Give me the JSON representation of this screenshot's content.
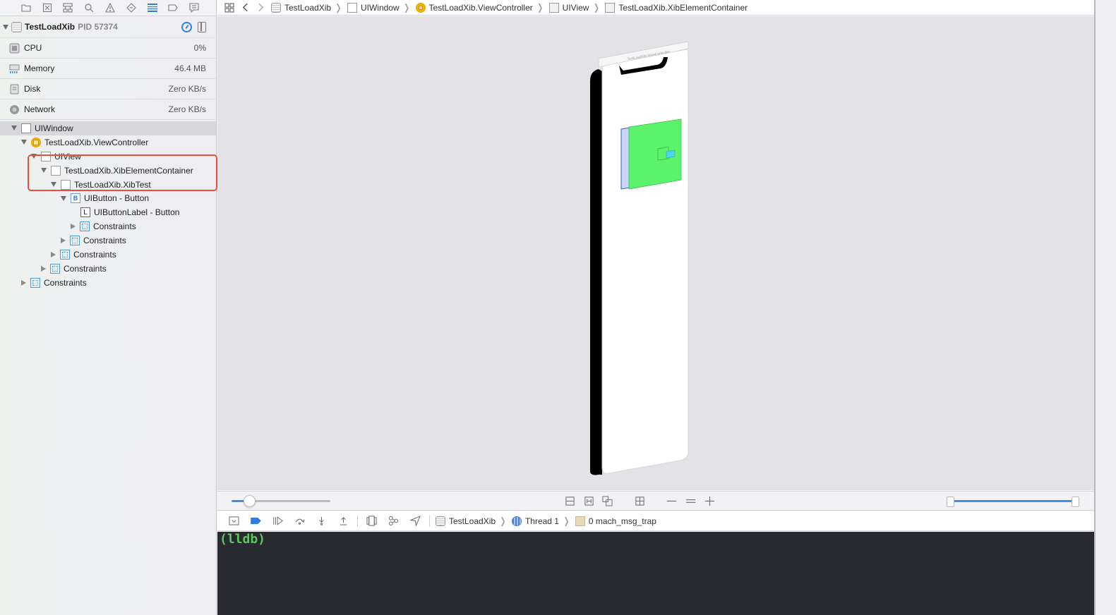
{
  "navigator": {
    "tabs": [
      {
        "icon": "folder-icon",
        "active": false
      },
      {
        "icon": "source-control-icon",
        "active": false
      },
      {
        "icon": "symbol-icon",
        "active": false
      },
      {
        "icon": "search-icon",
        "active": false
      },
      {
        "icon": "warning-icon",
        "active": false
      },
      {
        "icon": "test-icon",
        "active": false
      },
      {
        "icon": "debug-navigator-icon",
        "active": true
      },
      {
        "icon": "breakpoint-icon",
        "active": false
      },
      {
        "icon": "report-icon",
        "active": false
      }
    ],
    "process": {
      "name": "TestLoadXib",
      "pid_label": "PID 57374"
    },
    "gauges": [
      {
        "label": "CPU",
        "value": "0%",
        "icon": "cpu-icon"
      },
      {
        "label": "Memory",
        "value": "46.4 MB",
        "icon": "memory-icon"
      },
      {
        "label": "Disk",
        "value": "Zero KB/s",
        "icon": "disk-icon"
      },
      {
        "label": "Network",
        "value": "Zero KB/s",
        "icon": "network-icon"
      }
    ],
    "tree": [
      {
        "label": "UIWindow",
        "depth": 0,
        "expanded": true,
        "kind": "window",
        "selected": true
      },
      {
        "label": "TestLoadXib.ViewController",
        "depth": 1,
        "expanded": true,
        "kind": "vc"
      },
      {
        "label": "UIView",
        "depth": 2,
        "expanded": true,
        "kind": "view"
      },
      {
        "label": "TestLoadXib.XibElementContainer",
        "depth": 3,
        "expanded": true,
        "kind": "view"
      },
      {
        "label": "TestLoadXib.XibTest",
        "depth": 4,
        "expanded": true,
        "kind": "view"
      },
      {
        "label": "UIButton - Button",
        "depth": 5,
        "expanded": true,
        "kind": "button",
        "badge": "B"
      },
      {
        "label": "UIButtonLabel - Button",
        "depth": 6,
        "expanded": null,
        "kind": "label",
        "badge": "L"
      },
      {
        "label": "Constraints",
        "depth": 6,
        "expanded": false,
        "kind": "constraints"
      },
      {
        "label": "Constraints",
        "depth": 5,
        "expanded": false,
        "kind": "constraints"
      },
      {
        "label": "Constraints",
        "depth": 4,
        "expanded": false,
        "kind": "constraints"
      },
      {
        "label": "Constraints",
        "depth": 3,
        "expanded": false,
        "kind": "constraints"
      },
      {
        "label": "Constraints",
        "depth": 1,
        "expanded": false,
        "kind": "constraints"
      }
    ]
  },
  "jumpbar": {
    "crumbs": [
      {
        "label": "TestLoadXib",
        "icon": "app"
      },
      {
        "label": "UIWindow",
        "icon": "window"
      },
      {
        "label": "TestLoadXib.ViewController",
        "icon": "vc"
      },
      {
        "label": "UIView",
        "icon": "view"
      },
      {
        "label": "TestLoadXib.XibElementContainer",
        "icon": "view"
      }
    ]
  },
  "canvas": {
    "nav_bar_title": "TestLoadXib.ViewController",
    "colors": {
      "container_fill": "#c7d6f4",
      "xibtest_fill": "#5cf26c",
      "button_fill": "#4fd3f0"
    }
  },
  "canvas_bar": {
    "spacing_slider_value": 0.18,
    "range_slider": [
      0.0,
      1.0
    ]
  },
  "debug_bar": {
    "crumbs": [
      {
        "label": "TestLoadXib",
        "icon": "app"
      },
      {
        "label": "Thread 1",
        "icon": "thread"
      },
      {
        "label": "0 mach_msg_trap",
        "icon": "frame"
      }
    ]
  },
  "console": {
    "prompt": "(lldb)"
  }
}
